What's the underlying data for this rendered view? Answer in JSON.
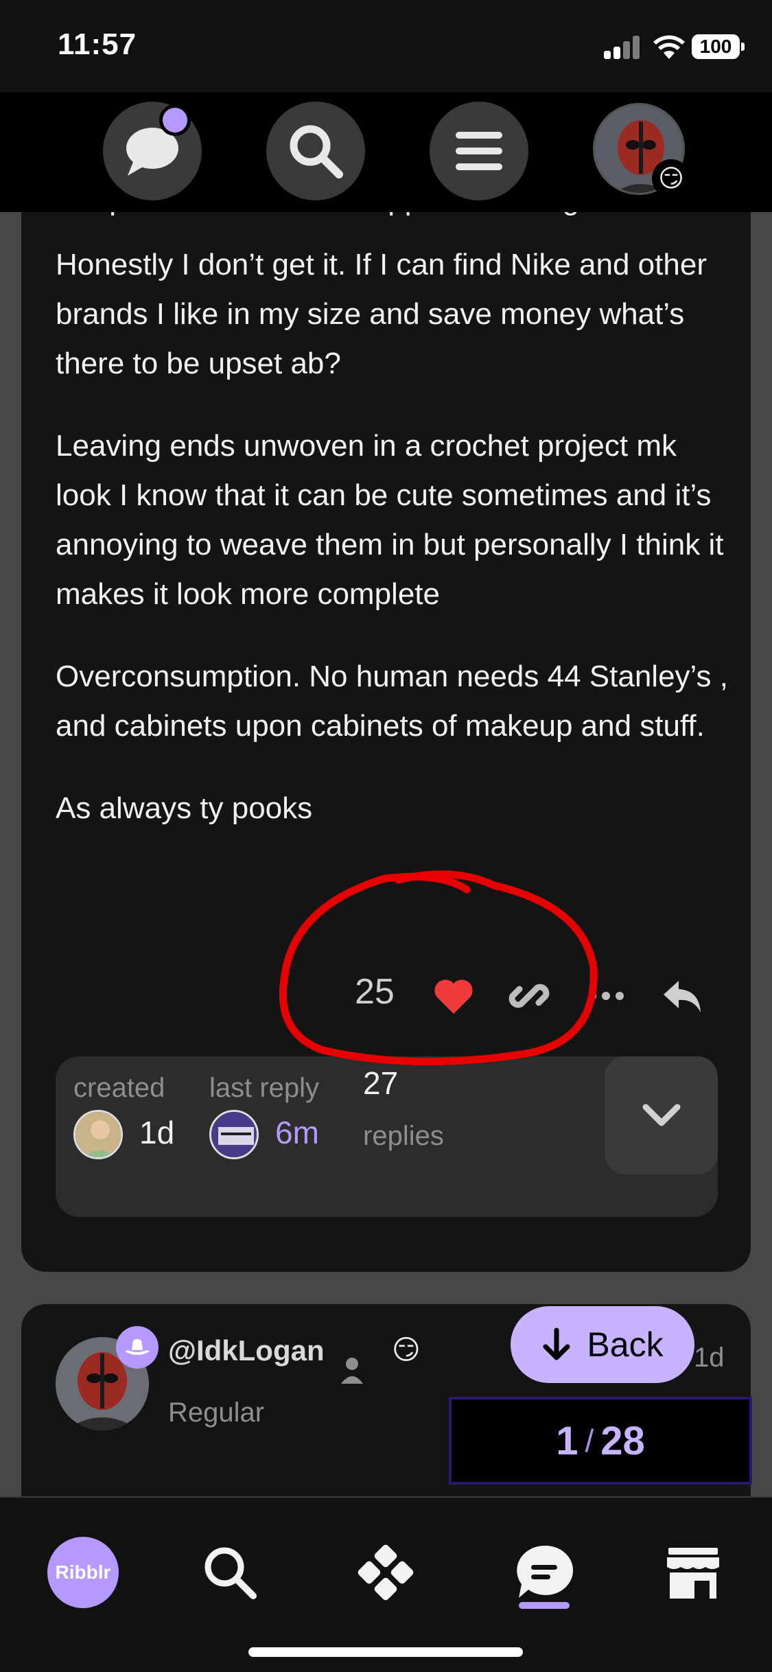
{
  "status_bar": {
    "time": "11:57",
    "battery": "100"
  },
  "post": {
    "cut_line": "People who make fun of ppl for thrifting.",
    "paragraphs": [
      "Honestly I don’t get it. If I can find Nike and other brands I like in my size and save money what’s there to be upset ab?",
      "Leaving ends unwoven in a crochet project mk look I know that it can be cute sometimes and it’s annoying to weave them in but personally I think it makes it look more complete",
      "Overconsumption. No human needs 44 Stanley’s , and cabinets upon cabinets of makeup and stuff.",
      "As always ty pooks"
    ],
    "like_count": "25",
    "summary": {
      "created_label": "created",
      "created_value": "1d",
      "last_reply_label": "last reply",
      "last_reply_value": "6m",
      "replies_count": "27",
      "replies_label": "replies"
    }
  },
  "next_post": {
    "username": "@IdkLogan",
    "user_title": "Regular",
    "status_emoji": "😏",
    "age": "1d"
  },
  "back_button": {
    "label": "Back"
  },
  "progress": {
    "current": "1",
    "total": "28"
  },
  "tab_bar": {
    "logo_text": "Ribblr"
  },
  "header": {
    "avatar_status_emoji": "😏"
  },
  "colors": {
    "accent": "#b599ff",
    "like": "#ef3b3b",
    "annotation": "#e60000"
  }
}
